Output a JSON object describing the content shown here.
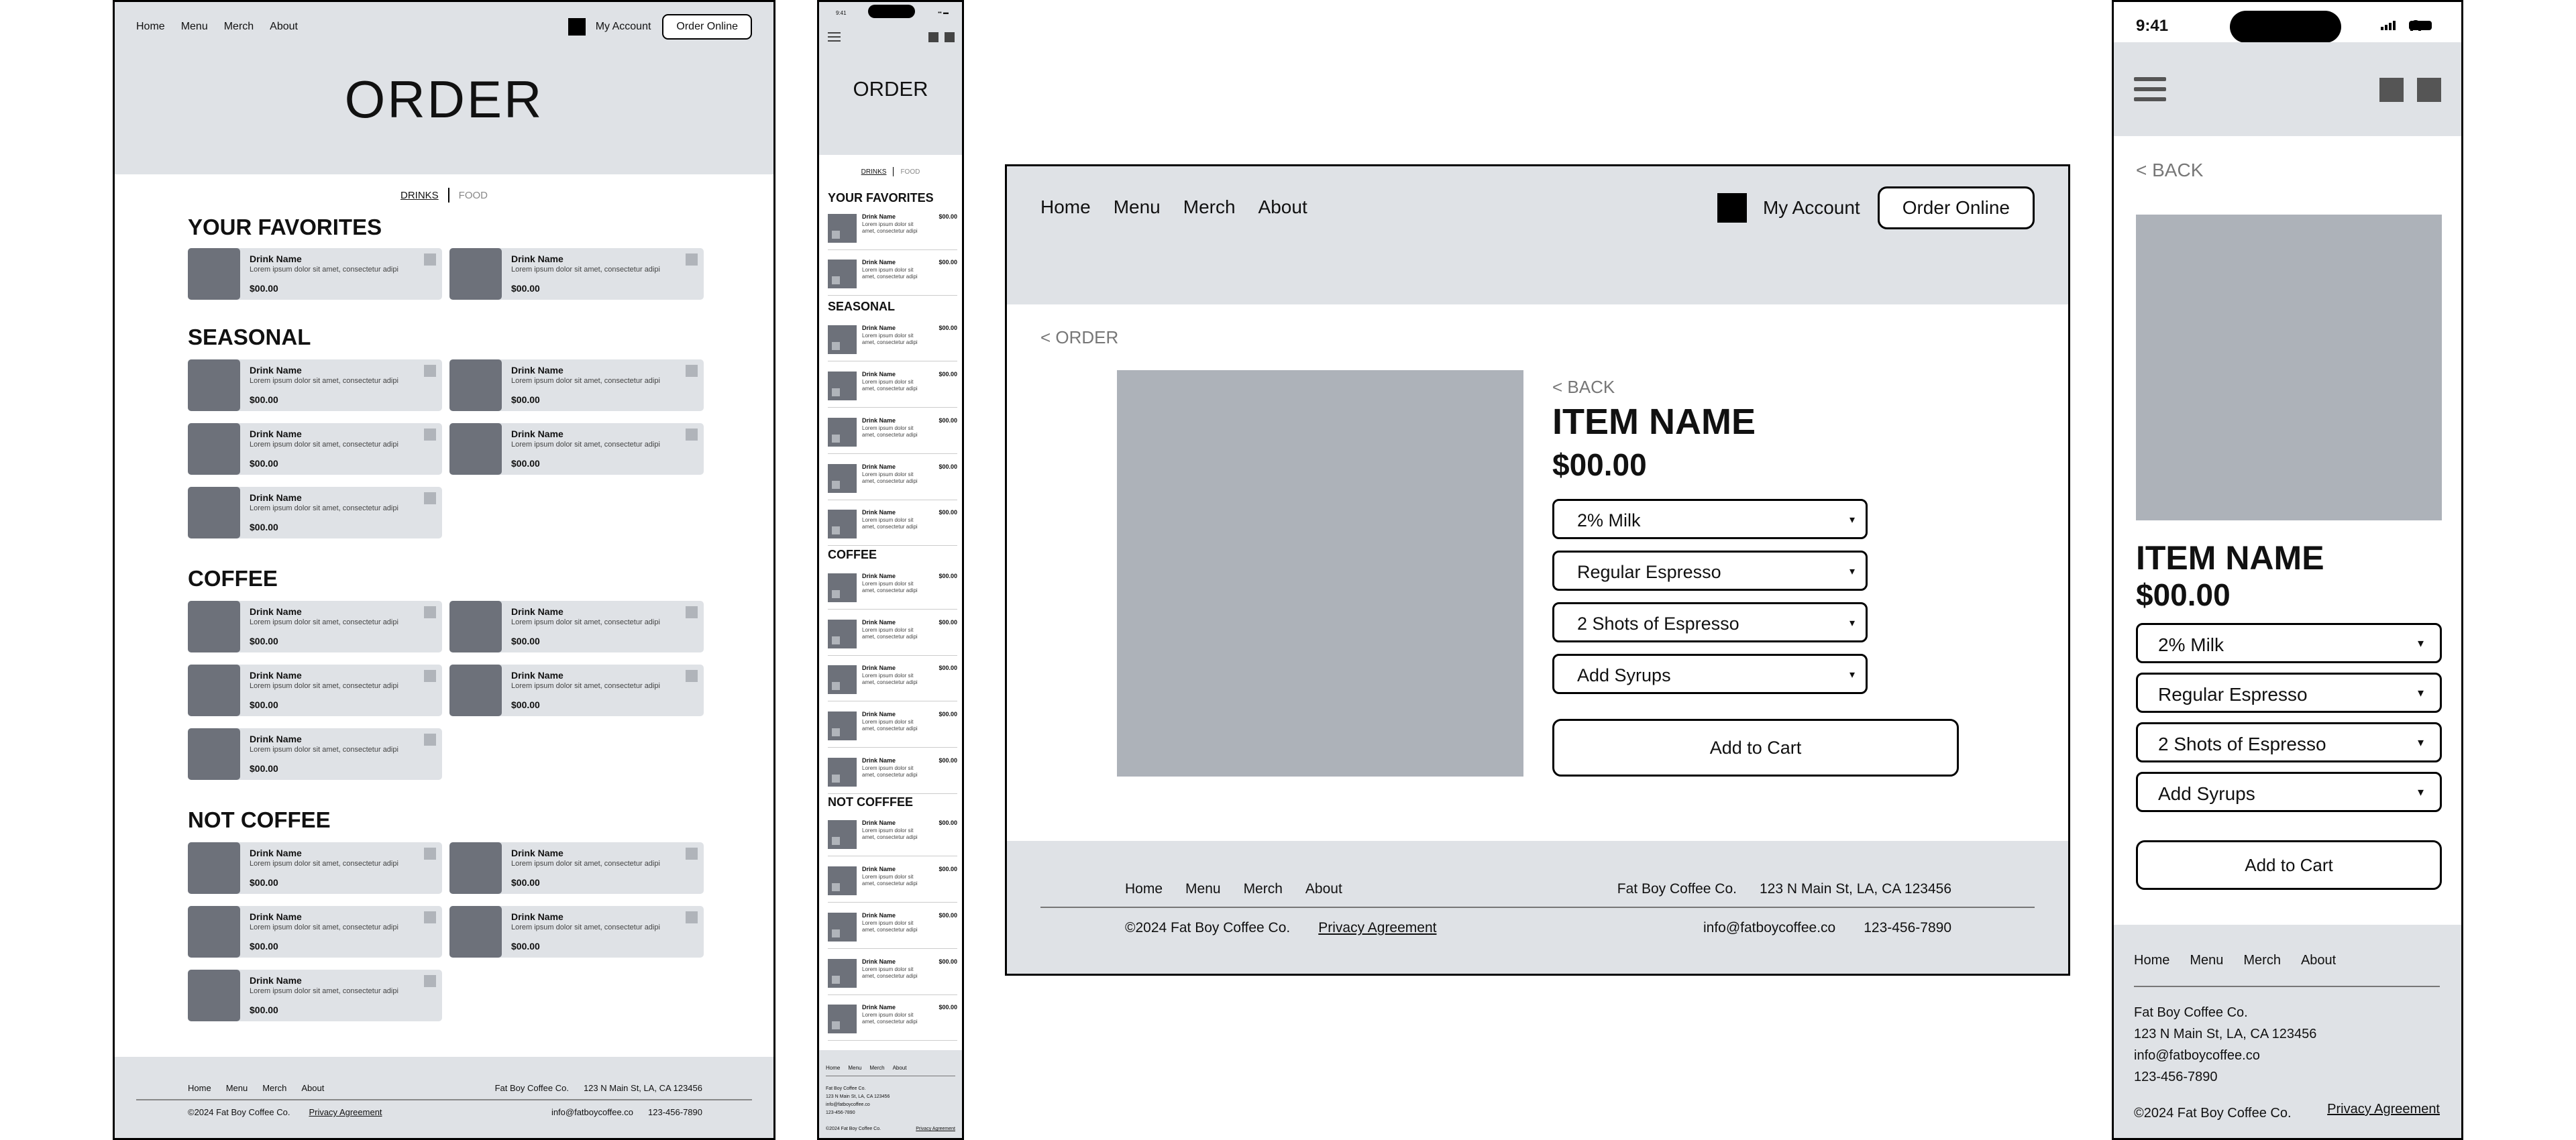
{
  "nav": {
    "home": "Home",
    "menu": "Menu",
    "merch": "Merch",
    "about": "About"
  },
  "account": {
    "label": "My Account",
    "order_button": "Order Online"
  },
  "order_title": "ORDER",
  "tabs": {
    "drinks": "DRINKS",
    "food": "FOOD"
  },
  "sections": {
    "favorites": "YOUR FAVORITES",
    "seasonal": "SEASONAL",
    "coffee": "COFFEE",
    "not_coffee": "NOT COFFEE",
    "not_coffee_mobile": "NOT COFFFEE"
  },
  "item": {
    "name": "Drink Name",
    "desc": "Lorem ipsum dolor sit amet, consectetur adipi",
    "desc_mobile": "Lorem ipsum dolor sit amet, consectetur adipi",
    "price": "$00.00"
  },
  "detail": {
    "breadcrumb": "< ORDER",
    "back": "< BACK",
    "item_name": "ITEM NAME",
    "price": "$00.00",
    "options": [
      "2% Milk",
      "Regular Espresso",
      "2 Shots of Espresso",
      "Add Syrups"
    ],
    "add_to_cart": "Add to Cart"
  },
  "footer": {
    "company": "Fat Boy Coffee Co.",
    "address": "123 N Main St, LA, CA 123456",
    "email": "info@fatboycoffee.co",
    "phone": "123-456-7890",
    "copyright": "©2024 Fat Boy Coffee Co.",
    "privacy": "Privacy Agreement"
  },
  "status_bar": {
    "time": "9:41"
  },
  "colors": {
    "hero_bg": "#dfe2e6",
    "thumb": "#6d717a",
    "image_placeholder": "#adb2b9"
  },
  "icons": [
    "account-icon",
    "hamburger-menu-icon",
    "cart-icon",
    "chevron-down-icon"
  ]
}
